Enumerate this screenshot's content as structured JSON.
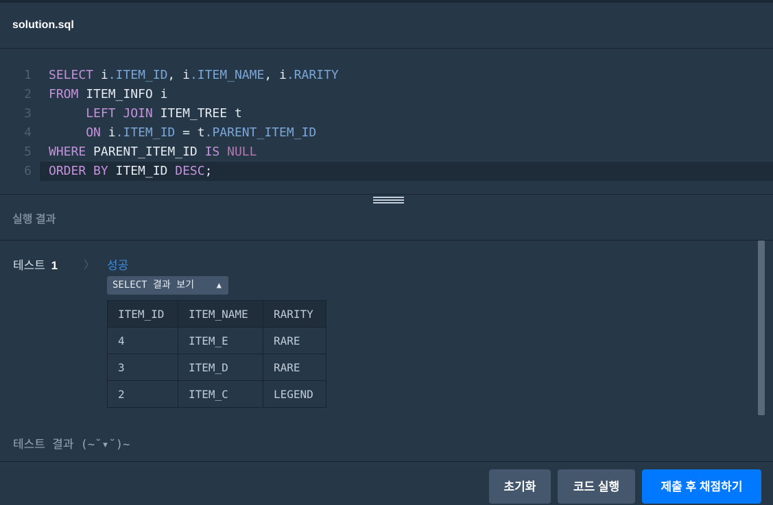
{
  "file": {
    "title": "solution.sql"
  },
  "editor": {
    "lines": [
      {
        "num": "1",
        "tokens": [
          {
            "t": "SELECT",
            "c": "kw"
          },
          {
            "t": " i",
            "c": "id"
          },
          {
            "t": ".ITEM_ID",
            "c": "prop"
          },
          {
            "t": ", i",
            "c": "id"
          },
          {
            "t": ".ITEM_NAME",
            "c": "prop"
          },
          {
            "t": ", i",
            "c": "id"
          },
          {
            "t": ".RARITY",
            "c": "prop"
          }
        ]
      },
      {
        "num": "2",
        "tokens": [
          {
            "t": "FROM",
            "c": "kw"
          },
          {
            "t": " ITEM_INFO i",
            "c": "id"
          }
        ]
      },
      {
        "num": "3",
        "tokens": [
          {
            "t": "     ",
            "c": "id"
          },
          {
            "t": "LEFT JOIN",
            "c": "kw"
          },
          {
            "t": " ITEM_TREE t",
            "c": "id"
          }
        ]
      },
      {
        "num": "4",
        "tokens": [
          {
            "t": "     ",
            "c": "id"
          },
          {
            "t": "ON",
            "c": "kw"
          },
          {
            "t": " i",
            "c": "id"
          },
          {
            "t": ".ITEM_ID",
            "c": "prop"
          },
          {
            "t": " = t",
            "c": "id"
          },
          {
            "t": ".PARENT_ITEM_ID",
            "c": "prop"
          }
        ]
      },
      {
        "num": "5",
        "tokens": [
          {
            "t": "WHERE",
            "c": "kw"
          },
          {
            "t": " PARENT_ITEM_ID ",
            "c": "id"
          },
          {
            "t": "IS",
            "c": "kw"
          },
          {
            "t": " ",
            "c": "id"
          },
          {
            "t": "NULL",
            "c": "null"
          }
        ]
      },
      {
        "num": "6",
        "active": true,
        "tokens": [
          {
            "t": "ORDER BY",
            "c": "kw"
          },
          {
            "t": " ITEM_ID ",
            "c": "id"
          },
          {
            "t": "DESC",
            "c": "kw"
          },
          {
            "t": ";",
            "c": "punc"
          }
        ]
      }
    ]
  },
  "results_panel": {
    "title": "실행 결과",
    "test_label": "테스트",
    "test_number": "1",
    "status": "성공",
    "select_toggle_label": "SELECT 결과 보기",
    "table": {
      "columns": [
        "ITEM_ID",
        "ITEM_NAME",
        "RARITY"
      ],
      "rows": [
        [
          "4",
          "ITEM_E",
          "RARE"
        ],
        [
          "3",
          "ITEM_D",
          "RARE"
        ],
        [
          "2",
          "ITEM_C",
          "LEGEND"
        ]
      ]
    },
    "summary": "테스트 결과 (~˘▾˘)~"
  },
  "footer": {
    "reset_label": "초기화",
    "run_label": "코드 실행",
    "submit_label": "제출 후 채점하기"
  },
  "colors": {
    "background": "#263747",
    "success": "#3a8fe2",
    "submit": "#0078ff",
    "secondary_button": "#44576c"
  }
}
